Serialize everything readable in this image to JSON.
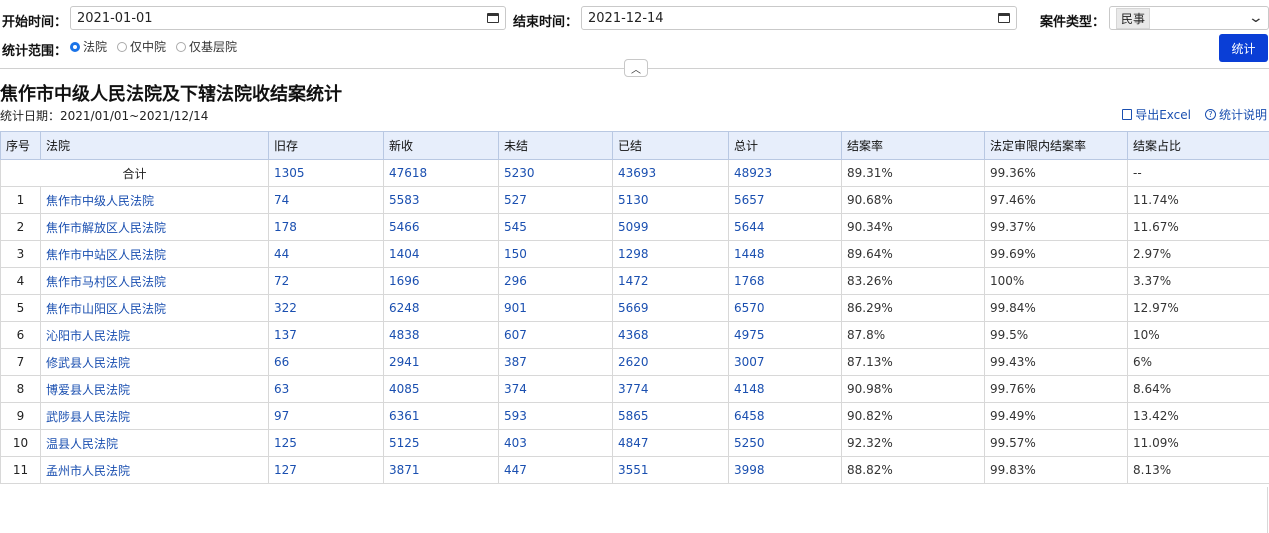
{
  "filters": {
    "start_label": "开始时间：",
    "start_value": "2021-01-01",
    "end_label": "结束时间：",
    "end_value": "2021-12-14",
    "case_type_label": "案件类型：",
    "case_type_value": "民事",
    "scope_label": "统计范围：",
    "scope_options": [
      "法院",
      "仅中院",
      "仅基层院"
    ],
    "scope_selected": "法院",
    "submit_label": "统计"
  },
  "report": {
    "title": "焦作市中级人民法院及下辖法院收结案统计",
    "date_range": "统计日期：2021/01/01~2021/12/14",
    "export_label": "导出Excel",
    "help_label": "统计说明"
  },
  "table": {
    "headers": [
      "序号",
      "法院",
      "旧存",
      "新收",
      "未结",
      "已结",
      "总计",
      "结案率",
      "法定审限内结案率",
      "结案占比"
    ],
    "total": {
      "label": "合计",
      "cells": [
        "1305",
        "47618",
        "5230",
        "43693",
        "48923",
        "89.31%",
        "99.36%",
        "--"
      ]
    },
    "rows": [
      [
        "1",
        "焦作市中级人民法院",
        "74",
        "5583",
        "527",
        "5130",
        "5657",
        "90.68%",
        "97.46%",
        "11.74%"
      ],
      [
        "2",
        "焦作市解放区人民法院",
        "178",
        "5466",
        "545",
        "5099",
        "5644",
        "90.34%",
        "99.37%",
        "11.67%"
      ],
      [
        "3",
        "焦作市中站区人民法院",
        "44",
        "1404",
        "150",
        "1298",
        "1448",
        "89.64%",
        "99.69%",
        "2.97%"
      ],
      [
        "4",
        "焦作市马村区人民法院",
        "72",
        "1696",
        "296",
        "1472",
        "1768",
        "83.26%",
        "100%",
        "3.37%"
      ],
      [
        "5",
        "焦作市山阳区人民法院",
        "322",
        "6248",
        "901",
        "5669",
        "6570",
        "86.29%",
        "99.84%",
        "12.97%"
      ],
      [
        "6",
        "沁阳市人民法院",
        "137",
        "4838",
        "607",
        "4368",
        "4975",
        "87.8%",
        "99.5%",
        "10%"
      ],
      [
        "7",
        "修武县人民法院",
        "66",
        "2941",
        "387",
        "2620",
        "3007",
        "87.13%",
        "99.43%",
        "6%"
      ],
      [
        "8",
        "博爱县人民法院",
        "63",
        "4085",
        "374",
        "3774",
        "4148",
        "90.98%",
        "99.76%",
        "8.64%"
      ],
      [
        "9",
        "武陟县人民法院",
        "97",
        "6361",
        "593",
        "5865",
        "6458",
        "90.82%",
        "99.49%",
        "13.42%"
      ],
      [
        "10",
        "温县人民法院",
        "125",
        "5125",
        "403",
        "4847",
        "5250",
        "92.32%",
        "99.57%",
        "11.09%"
      ],
      [
        "11",
        "孟州市人民法院",
        "127",
        "3871",
        "447",
        "3551",
        "3998",
        "88.82%",
        "99.83%",
        "8.13%"
      ]
    ]
  }
}
